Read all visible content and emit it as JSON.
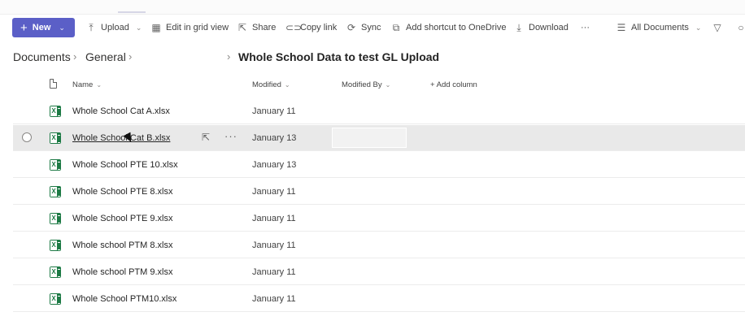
{
  "command_bar": {
    "new_label": "New",
    "upload_label": "Upload",
    "grid_view_label": "Edit in grid view",
    "share_label": "Share",
    "copy_link_label": "Copy link",
    "sync_label": "Sync",
    "shortcut_label": "Add shortcut to OneDrive",
    "download_label": "Download",
    "more_label": "···",
    "view_label": "All Documents",
    "accent_color": "#5b5fc7"
  },
  "breadcrumb": {
    "root": "Documents",
    "middle": "General",
    "current": "Whole School Data to test GL Upload"
  },
  "columns": {
    "name": "Name",
    "modified": "Modified",
    "modified_by": "Modified By",
    "add_column": "+ Add column"
  },
  "files": [
    {
      "name": "Whole School Cat A.xlsx",
      "modified": "January 11"
    },
    {
      "name": "Whole School Cat B.xlsx",
      "modified": "January 13"
    },
    {
      "name": "Whole School PTE 10.xlsx",
      "modified": "January 13"
    },
    {
      "name": "Whole School PTE 8.xlsx",
      "modified": "January 11"
    },
    {
      "name": "Whole School PTE 9.xlsx",
      "modified": "January 11"
    },
    {
      "name": "Whole school PTM 8.xlsx",
      "modified": "January 11"
    },
    {
      "name": "Whole school PTM 9.xlsx",
      "modified": "January 11"
    },
    {
      "name": "Whole School PTM10.xlsx",
      "modified": "January 11"
    }
  ],
  "icons": {
    "file_type": "excel-icon",
    "excel_color": "#1d7a45"
  }
}
